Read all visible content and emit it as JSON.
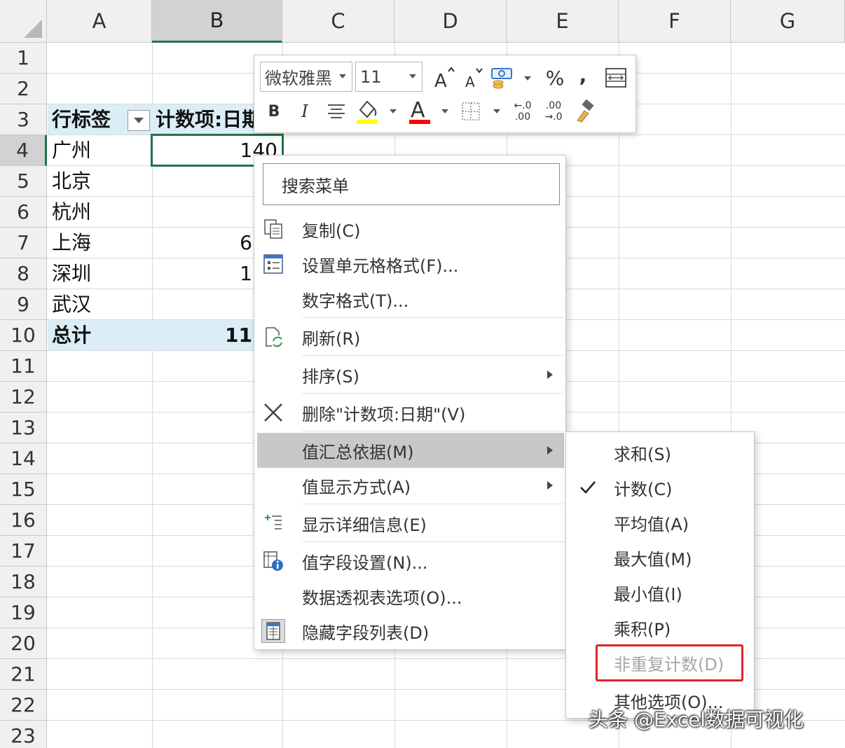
{
  "columns": [
    "A",
    "B",
    "C",
    "D",
    "E",
    "F",
    "G"
  ],
  "rows": [
    "1",
    "2",
    "3",
    "4",
    "5",
    "6",
    "7",
    "8",
    "9",
    "10",
    "11",
    "12",
    "13",
    "14",
    "15",
    "16",
    "17",
    "18",
    "19",
    "20",
    "21",
    "22",
    "23"
  ],
  "pivot": {
    "header_label": "行标签",
    "header_value": "计数项:日期",
    "rows": [
      {
        "label": "广州",
        "value": "140"
      },
      {
        "label": "北京",
        "value": ""
      },
      {
        "label": "杭州",
        "value": ""
      },
      {
        "label": "上海",
        "value": "6"
      },
      {
        "label": "深圳",
        "value": "1"
      },
      {
        "label": "武汉",
        "value": ""
      }
    ],
    "total_label": "总计",
    "total_value": "11"
  },
  "minibar": {
    "font_name": "微软雅黑",
    "font_size": "11",
    "grow_font_icon": "grow-font-icon",
    "shrink_font_icon": "shrink-font-icon",
    "percent_label": "%",
    "comma_label": ",",
    "bold_label": "B",
    "italic_label": "I",
    "font_color_label": "A",
    "increase_decimal_top": "←.0",
    "increase_decimal_bottom": ".00",
    "decrease_decimal_top": ".00",
    "decrease_decimal_bottom": "→.0",
    "fill_color": "#ffff00",
    "font_color": "#ff0000"
  },
  "context_menu": {
    "search_placeholder": "搜索菜单",
    "items": [
      {
        "label": "复制(C)",
        "icon": "copy-icon",
        "submenu": false
      },
      {
        "label": "设置单元格格式(F)...",
        "icon": "format-cells-icon",
        "submenu": false
      },
      {
        "label": "数字格式(T)...",
        "icon": "",
        "submenu": false
      },
      {
        "label": "刷新(R)",
        "icon": "refresh-icon",
        "submenu": false
      },
      {
        "label": "排序(S)",
        "icon": "",
        "submenu": true
      },
      {
        "label": "删除\"计数项:日期\"(V)",
        "icon": "delete-icon",
        "submenu": false
      },
      {
        "label": "值汇总依据(M)",
        "icon": "",
        "submenu": true
      },
      {
        "label": "值显示方式(A)",
        "icon": "",
        "submenu": true
      },
      {
        "label": "显示详细信息(E)",
        "icon": "show-details-icon",
        "submenu": false
      },
      {
        "label": "值字段设置(N)...",
        "icon": "field-settings-icon",
        "submenu": false
      },
      {
        "label": "数据透视表选项(O)...",
        "icon": "",
        "submenu": false
      },
      {
        "label": "隐藏字段列表(D)",
        "icon": "field-list-icon",
        "submenu": false
      }
    ]
  },
  "summarize_submenu": {
    "items": [
      {
        "label": "求和(S)",
        "checked": false,
        "disabled": false
      },
      {
        "label": "计数(C)",
        "checked": true,
        "disabled": false
      },
      {
        "label": "平均值(A)",
        "checked": false,
        "disabled": false
      },
      {
        "label": "最大值(M)",
        "checked": false,
        "disabled": false
      },
      {
        "label": "最小值(I)",
        "checked": false,
        "disabled": false
      },
      {
        "label": "乘积(P)",
        "checked": false,
        "disabled": false
      },
      {
        "label": "非重复计数(D)",
        "checked": false,
        "disabled": true
      },
      {
        "label": "其他选项(O)...",
        "checked": false,
        "disabled": false
      }
    ]
  },
  "watermark": "头条 @Excel数据可视化",
  "colors": {
    "selection_green": "#217346",
    "pivot_band": "#dbeef8",
    "highlight_red": "#e0242a"
  }
}
